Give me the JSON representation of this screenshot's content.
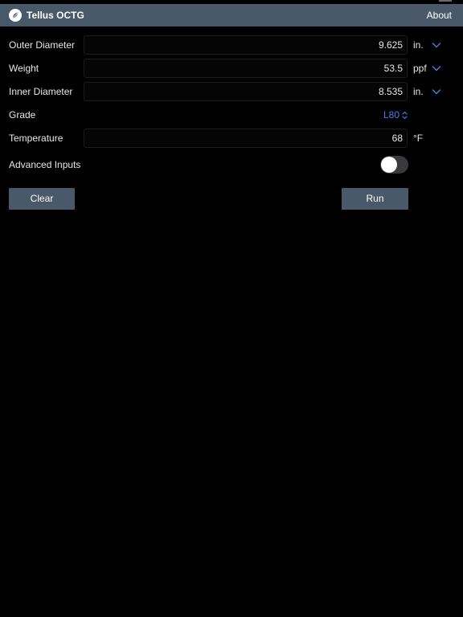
{
  "header": {
    "app_title": "Tellus OCTG",
    "about_label": "About",
    "logo_icon": "leaf-icon"
  },
  "colors": {
    "header_bg": "#4a5969",
    "accent_blue": "#4a7fe8",
    "background": "#000000"
  },
  "form": {
    "outer_diameter": {
      "label": "Outer Diameter",
      "value": "9.625",
      "unit": "in."
    },
    "weight": {
      "label": "Weight",
      "value": "53.5",
      "unit": "ppf"
    },
    "inner_diameter": {
      "label": "Inner Diameter",
      "value": "8.535",
      "unit": "in."
    },
    "grade": {
      "label": "Grade",
      "value": "L80"
    },
    "temperature": {
      "label": "Temperature",
      "value": "68",
      "unit": "°F"
    },
    "advanced_inputs": {
      "label": "Advanced Inputs",
      "enabled": false
    }
  },
  "actions": {
    "clear_label": "Clear",
    "run_label": "Run"
  }
}
